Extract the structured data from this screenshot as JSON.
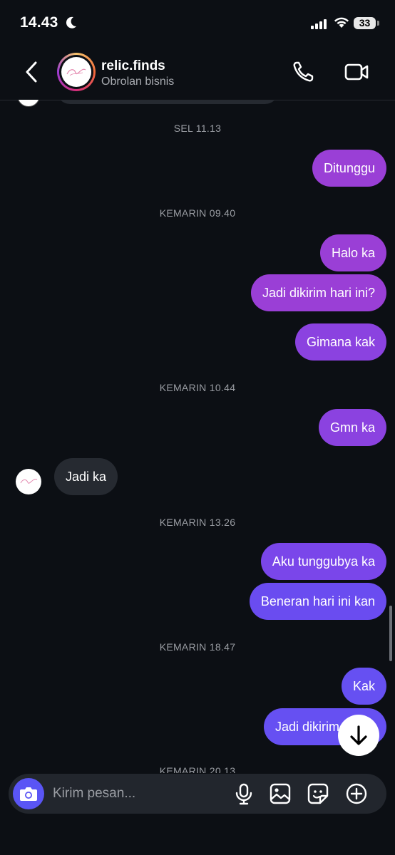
{
  "status": {
    "time": "14.43",
    "battery": "33"
  },
  "header": {
    "name": "relic.finds",
    "subtitle": "Obrolan bisnis"
  },
  "timestamps": [
    "SEL 11.13",
    "KEMARIN 09.40",
    "KEMARIN 10.44",
    "KEMARIN 13.26",
    "KEMARIN 18.47",
    "KEMARIN 20.13"
  ],
  "messages": [
    {
      "from": "me",
      "text": "Ditunggu"
    },
    {
      "from": "me",
      "text": "Halo ka"
    },
    {
      "from": "me",
      "text": "Jadi dikirim hari ini?"
    },
    {
      "from": "me",
      "text": "Gimana kak"
    },
    {
      "from": "me",
      "text": "Gmn ka"
    },
    {
      "from": "them",
      "text": "Jadi ka"
    },
    {
      "from": "me",
      "text": "Aku tunggubya ka"
    },
    {
      "from": "me",
      "text": "Beneran hari ini kan"
    },
    {
      "from": "me",
      "text": "Kak"
    },
    {
      "from": "me",
      "text": "Jadi dikirim"
    }
  ],
  "composer": {
    "placeholder": "Kirim pesan..."
  },
  "icons": {
    "back": "chevron-left-icon",
    "call": "phone-icon",
    "video": "video-camera-icon",
    "camera": "camera-icon",
    "mic": "microphone-icon",
    "gallery": "image-icon",
    "sticker": "sticker-icon",
    "add": "plus-circle-icon",
    "scroll_down": "arrow-down-icon"
  },
  "colors": {
    "background": "#0c0f14",
    "incoming_bubble": "#262a31",
    "outgoing_top": "#9a3fd6",
    "outgoing_bottom": "#6650f2",
    "camera_button": "#5a55f5"
  }
}
